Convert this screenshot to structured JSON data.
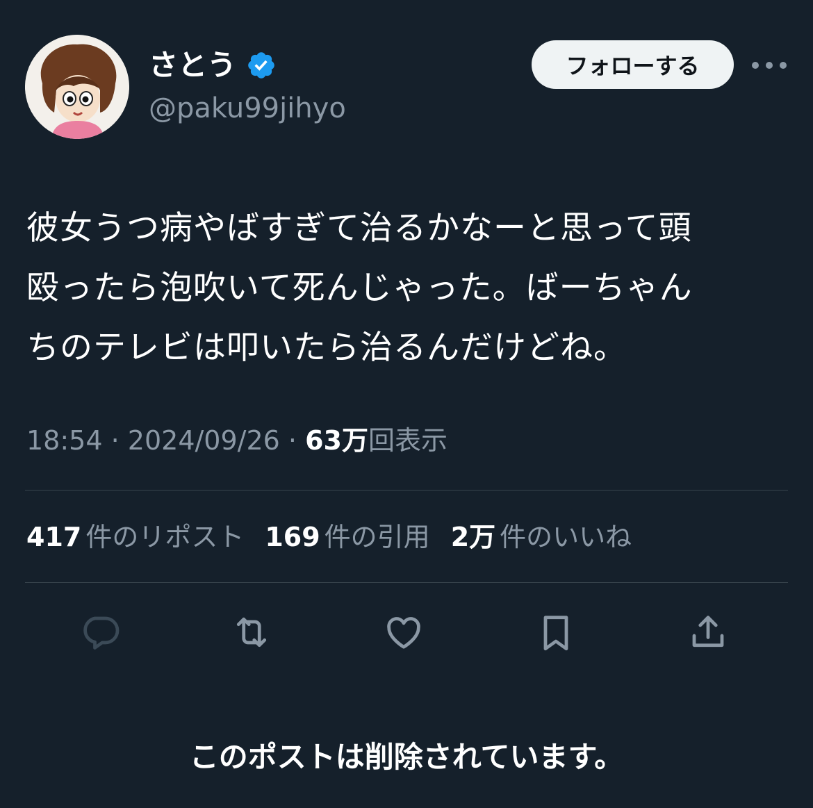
{
  "author": {
    "display_name": "さとう",
    "handle": "@paku99jihyo",
    "verified": true,
    "avatar_icon": "cartoon-woman-avatar"
  },
  "header": {
    "follow_label": "フォローする",
    "more_icon": "more-dots-icon"
  },
  "tweet": {
    "lines": [
      "彼女うつ病やばすぎて治るかなーと思って頭",
      "殴ったら泡吹いて死んじゃった。ばーちゃん",
      "ちのテレビは叩いたら治るんだけどね。"
    ]
  },
  "meta": {
    "time": "18:54",
    "separator": "·",
    "date": "2024/09/26",
    "views_count": "63万",
    "views_label": "回表示"
  },
  "stats": {
    "reposts_count": "417",
    "reposts_label": "件のリポスト",
    "quotes_count": "169",
    "quotes_label": "件の引用",
    "likes_count": "2万",
    "likes_label": "件のいいね"
  },
  "actions": [
    "reply-icon",
    "repost-icon",
    "like-icon",
    "bookmark-icon",
    "share-icon"
  ],
  "colors": {
    "background": "#15202b",
    "text": "#ffffff",
    "secondary_text": "#8b98a5",
    "divider": "#38444d",
    "verified_blue": "#1d9bf0",
    "follow_button_bg": "#eff3f4"
  },
  "footer": {
    "deleted_notice": "このポストは削除されています。"
  }
}
